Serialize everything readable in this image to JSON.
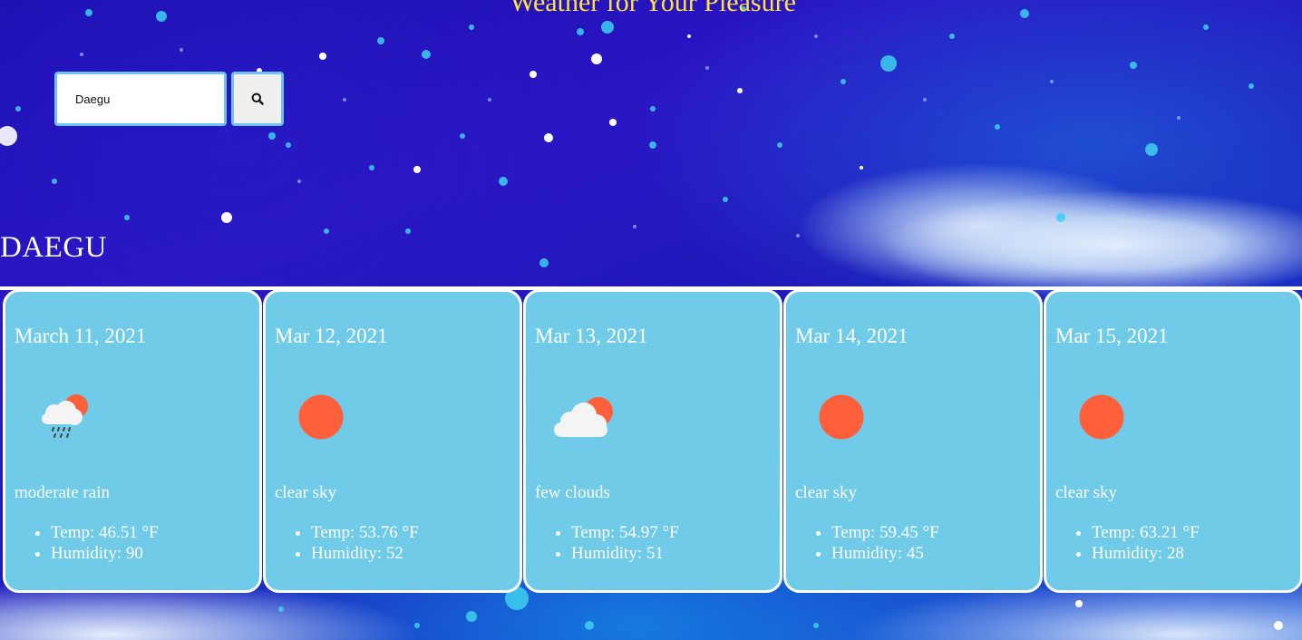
{
  "header": {
    "title": "Weather for Your Pleasure"
  },
  "search": {
    "value": "Daegu",
    "button_icon": "search-icon"
  },
  "city": {
    "name": "DAEGU"
  },
  "forecast": [
    {
      "date": "March 11, 2021",
      "icon": "rain-cloud-sun-icon",
      "description": "moderate rain",
      "temp": "Temp: 46.51 °F",
      "humidity": "Humidity: 90"
    },
    {
      "date": "Mar 12, 2021",
      "icon": "sun-icon",
      "description": "clear sky",
      "temp": "Temp: 53.76 °F",
      "humidity": "Humidity: 52"
    },
    {
      "date": "Mar 13, 2021",
      "icon": "cloud-sun-icon",
      "description": "few clouds",
      "temp": "Temp: 54.97 °F",
      "humidity": "Humidity: 51"
    },
    {
      "date": "Mar 14, 2021",
      "icon": "sun-icon",
      "description": "clear sky",
      "temp": "Temp: 59.45 °F",
      "humidity": "Humidity: 45"
    },
    {
      "date": "Mar 15, 2021",
      "icon": "sun-icon",
      "description": "clear sky",
      "temp": "Temp: 63.21 °F",
      "humidity": "Humidity: 28"
    }
  ],
  "colors": {
    "title": "#ffe23b",
    "card": "#70cbe9",
    "card_border": "#ffffff",
    "input_border": "#6fc3ee",
    "sun": "#ff5f3a"
  }
}
